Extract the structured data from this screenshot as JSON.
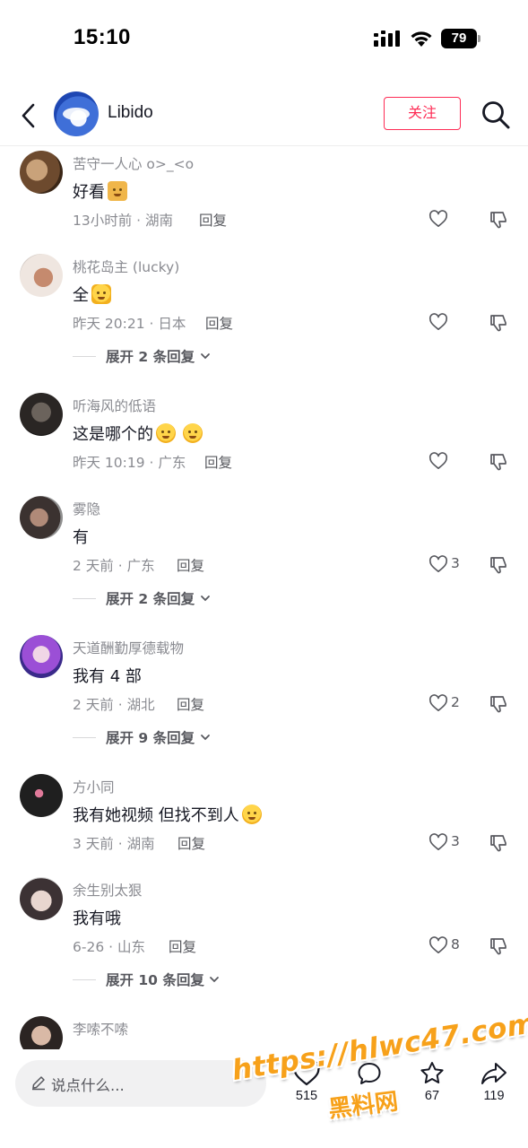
{
  "status_bar": {
    "time": "15:10",
    "battery": "79"
  },
  "header": {
    "name": "Libido",
    "follow_label": "关注"
  },
  "comments": [
    {
      "name": "苦守一人心 o>_<o",
      "text": "好看",
      "time_location": "13小时前 · 湖南",
      "reply_label": "回复",
      "likes": ""
    },
    {
      "name": "桃花岛主 (lucky)",
      "text": "全",
      "time_location": "昨天 20:21 · 日本",
      "reply_label": "回复",
      "likes": "",
      "expand_label": "展开 2 条回复"
    },
    {
      "name": "听海风的低语",
      "text": "这是哪个的",
      "time_location": "昨天 10:19 · 广东",
      "reply_label": "回复",
      "likes": ""
    },
    {
      "name": "雾隐",
      "text": "有",
      "time_location": "2 天前 · 广东",
      "reply_label": "回复",
      "likes": "3",
      "expand_label": "展开 2 条回复"
    },
    {
      "name": "天道酬勤厚德载物",
      "text": "我有 4 部",
      "time_location": "2 天前 · 湖北",
      "reply_label": "回复",
      "likes": "2",
      "expand_label": "展开 9 条回复"
    },
    {
      "name": "方小同",
      "text": "我有她视频 但找不到人",
      "time_location": "3 天前 · 湖南",
      "reply_label": "回复",
      "likes": "3"
    },
    {
      "name": "余生别太狠",
      "text": "我有哦",
      "time_location": "6-26 · 山东",
      "reply_label": "回复",
      "likes": "8",
      "expand_label": "展开 10 条回复"
    },
    {
      "name": "李嗦不嗦",
      "text": "",
      "time_location": "",
      "reply_label": "",
      "likes": ""
    }
  ],
  "bottom_bar": {
    "placeholder": "说点什么...",
    "like_count": "515",
    "comment_count": "",
    "favorite_count": "67",
    "share_count": "119"
  },
  "watermark": {
    "url": "https://hlwc47.com",
    "sub": "黑料网"
  },
  "colors": {
    "accent": "#fe2c55",
    "secondary_text": "#8a8b91",
    "watermark": "#f7a11a"
  }
}
